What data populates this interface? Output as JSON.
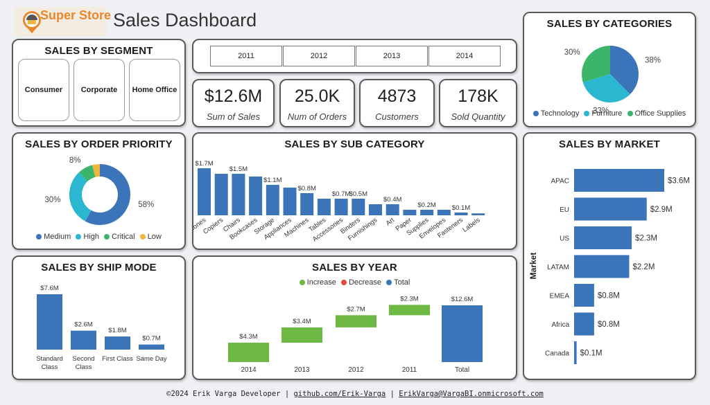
{
  "header": {
    "app_name": "Super Store",
    "title": "Sales Dashboard"
  },
  "colors": {
    "blue": "#3b74b9",
    "cyan": "#2bb7d0",
    "green": "#3bb56a",
    "yellow": "#f0b63e",
    "increase": "#6db943",
    "decrease": "#e8473c",
    "logo_orange": "#e8872c"
  },
  "segment": {
    "title": "SALES BY SEGMENT",
    "buttons": [
      "Consumer",
      "Corporate",
      "Home Office"
    ]
  },
  "years": [
    "2011",
    "2012",
    "2013",
    "2014"
  ],
  "kpis": [
    {
      "value": "$12.6M",
      "label": "Sum of Sales"
    },
    {
      "value": "25.0K",
      "label": "Num of Orders"
    },
    {
      "value": "4873",
      "label": "Customers"
    },
    {
      "value": "178K",
      "label": "Sold Quantity"
    }
  ],
  "chart_data": [
    {
      "id": "categories",
      "type": "pie",
      "title": "SALES BY CATEGORIES",
      "slices": [
        {
          "name": "Technology",
          "value": 38,
          "label": "38%",
          "color": "#3b74b9"
        },
        {
          "name": "Furniture",
          "value": 33,
          "label": "33%",
          "color": "#2bb7d0"
        },
        {
          "name": "Office Supplies",
          "value": 30,
          "label": "30%",
          "color": "#3bb56a"
        }
      ]
    },
    {
      "id": "order_priority",
      "type": "pie",
      "title": "SALES BY ORDER PRIORITY",
      "slices": [
        {
          "name": "Medium",
          "value": 58,
          "label": "58%",
          "color": "#3b74b9"
        },
        {
          "name": "High",
          "value": 30,
          "label": "30%",
          "color": "#2bb7d0"
        },
        {
          "name": "Critical",
          "value": 8,
          "label": "8%",
          "color": "#3bb56a"
        },
        {
          "name": "Low",
          "value": 4,
          "label": "",
          "color": "#f0b63e"
        }
      ]
    },
    {
      "id": "sub_category",
      "type": "bar",
      "title": "SALES BY SUB CATEGORY",
      "categories": [
        "Phones",
        "Copiers",
        "Chairs",
        "Bookcases",
        "Storage",
        "Appliances",
        "Machines",
        "Tables",
        "Accessories",
        "Binders",
        "Furnishings",
        "Art",
        "Paper",
        "Supplies",
        "Envelopes",
        "Fasteners",
        "Labels"
      ],
      "values": [
        1.7,
        1.5,
        1.5,
        1.4,
        1.1,
        1.0,
        0.8,
        0.6,
        0.6,
        0.6,
        0.4,
        0.4,
        0.2,
        0.2,
        0.2,
        0.1,
        0.07
      ],
      "data_labels": [
        "$1.7M",
        "",
        "$1.5M",
        "",
        "$1.1M",
        "",
        "$0.8M",
        "",
        "$0.7M",
        "$0.5M",
        "",
        "$0.4M",
        "",
        "$0.2M",
        "",
        "$0.1M",
        ""
      ],
      "color": "#3b74b9"
    },
    {
      "id": "market",
      "type": "bar",
      "orientation": "horizontal",
      "title": "SALES BY MARKET",
      "ylabel": "Market",
      "categories": [
        "APAC",
        "EU",
        "US",
        "LATAM",
        "EMEA",
        "Africa",
        "Canada"
      ],
      "values": [
        3.6,
        2.9,
        2.3,
        2.2,
        0.8,
        0.8,
        0.1
      ],
      "data_labels": [
        "$3.6M",
        "$2.9M",
        "$2.3M",
        "$2.2M",
        "$0.8M",
        "$0.8M",
        "$0.1M"
      ],
      "color": "#3b74b9"
    },
    {
      "id": "ship_mode",
      "type": "bar",
      "title": "SALES BY SHIP MODE",
      "categories": [
        "Standard Class",
        "Second Class",
        "First Class",
        "Same Day"
      ],
      "category_lines": [
        [
          "Standard",
          "Class"
        ],
        [
          "Second",
          "Class"
        ],
        [
          "First Class"
        ],
        [
          "Same Day"
        ]
      ],
      "values": [
        7.6,
        2.6,
        1.8,
        0.7
      ],
      "data_labels": [
        "$7.6M",
        "$2.6M",
        "$1.8M",
        "$0.7M"
      ],
      "color": "#3b74b9"
    },
    {
      "id": "year",
      "type": "bar",
      "subtype": "waterfall",
      "title": "SALES BY YEAR",
      "legend": [
        {
          "name": "Increase",
          "color": "#6db943"
        },
        {
          "name": "Decrease",
          "color": "#e8473c"
        },
        {
          "name": "Total",
          "color": "#3b74b9"
        }
      ],
      "categories": [
        "2014",
        "2013",
        "2012",
        "2011",
        "Total"
      ],
      "values": [
        4.3,
        3.4,
        2.7,
        2.3,
        12.6
      ],
      "kinds": [
        "increase",
        "increase",
        "increase",
        "increase",
        "total"
      ],
      "data_labels": [
        "$4.3M",
        "$3.4M",
        "$2.7M",
        "$2.3M",
        "$12.6M"
      ]
    }
  ],
  "footer": {
    "credit": "©2024 Erik Varga Developer",
    "separator": "|",
    "link": "github.com/Erik-Varga",
    "email": "ErikVarga@VargaBI.onmicrosoft.com"
  }
}
